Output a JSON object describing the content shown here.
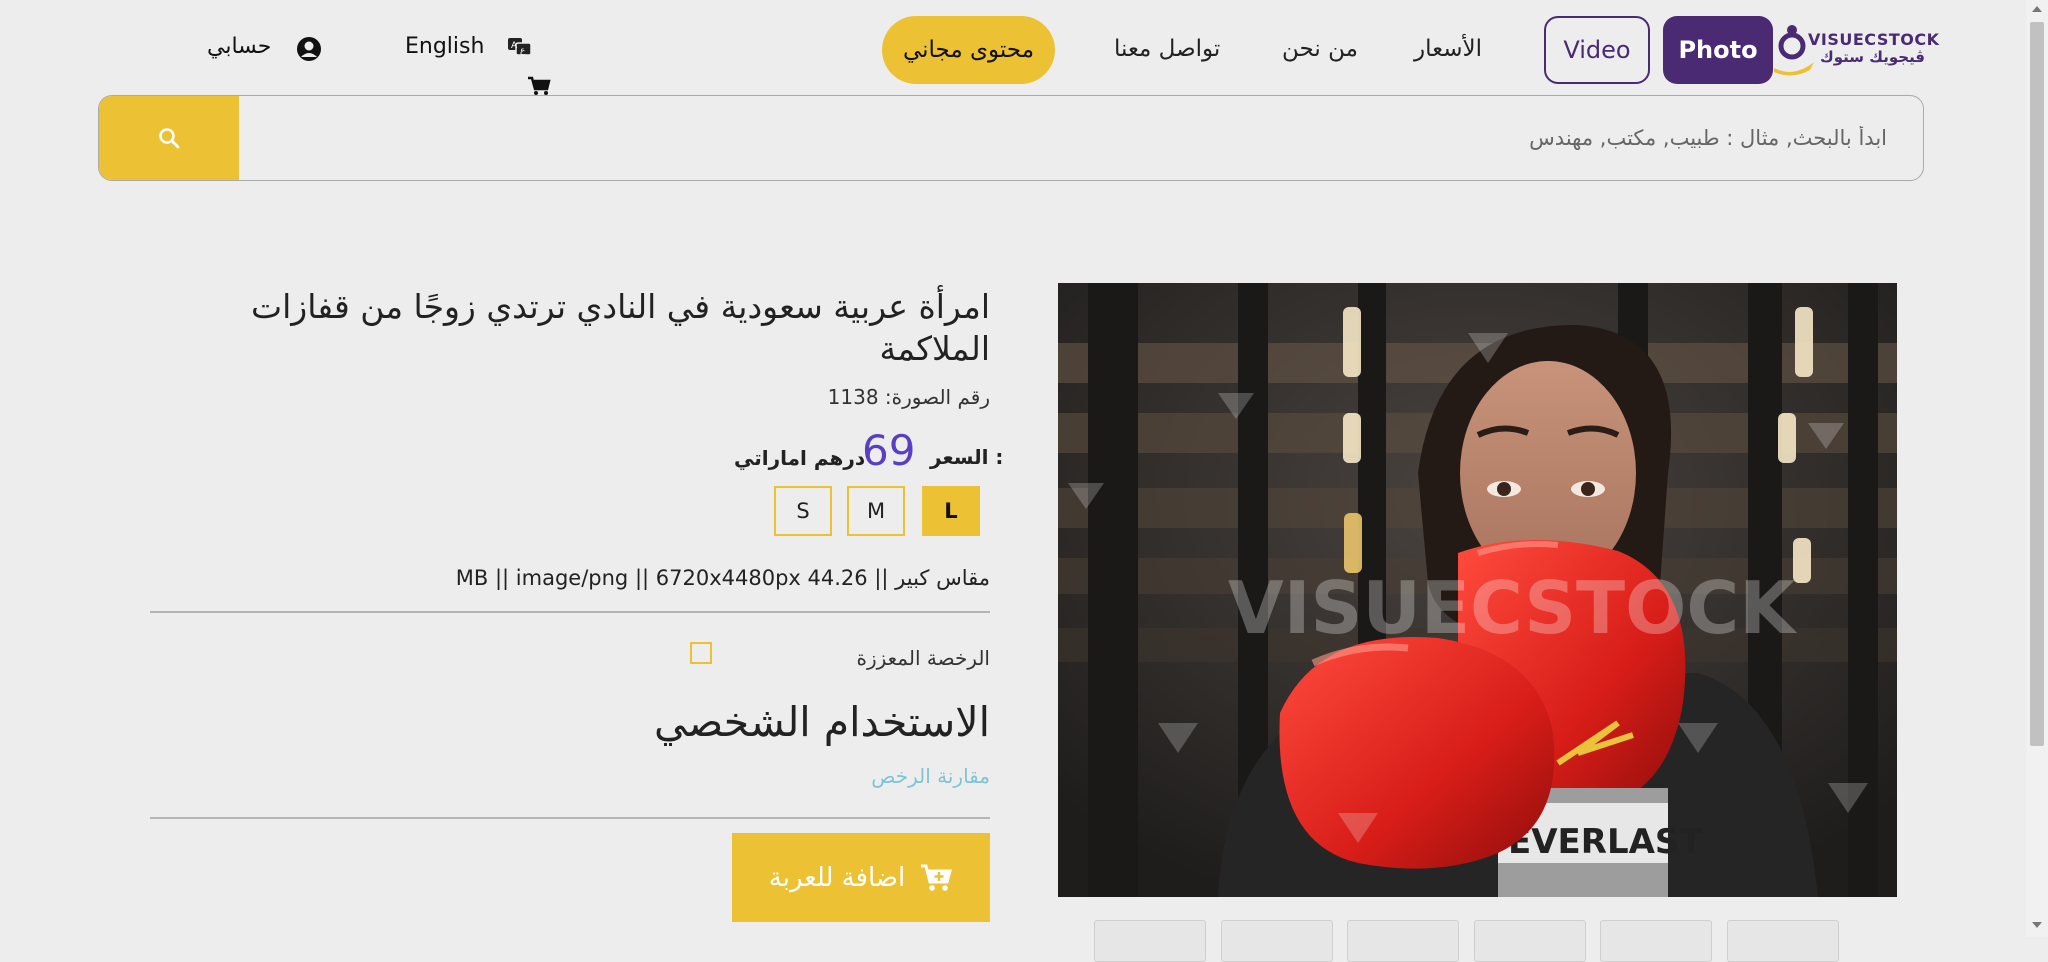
{
  "header": {
    "logo_text_en": "VISUECSTOCK",
    "logo_text_ar": "ڤيجويك ستوك",
    "photo_button": "Photo",
    "video_button": "Video",
    "nav": {
      "pricing": "الأسعار",
      "about": "من نحن",
      "contact": "تواصل معنا"
    },
    "free_content": "محتوى مجاني",
    "language": "English",
    "account": "حسابي"
  },
  "search": {
    "placeholder": "ابدأ بالبحث, مثال : طبيب, مكتب, مهندس",
    "value": ""
  },
  "product": {
    "title": "امرأة عربية سعودية في النادي ترتدي زوجًا من قفازات الملاكمة",
    "photo_number": "رقم الصورة: 1138",
    "price_label": "السعر :",
    "price_value": "69",
    "currency": "درهم اماراتي",
    "sizes": [
      "L",
      "M",
      "S"
    ],
    "selected_size": "L",
    "specs": "مقاس كبير || 44.26 MB || image/png || 6720x4480px",
    "extended_license_label": "الرخصة المعززة",
    "extended_license_checked": false,
    "license_type": "الاستخدام الشخصي",
    "compare_licenses": "مقارنة الرخص",
    "add_to_cart": "اضافة للعربة"
  },
  "image": {
    "watermark": "VISUECSTOCK",
    "glove_brand": "EVERLAST"
  },
  "colors": {
    "accent": "#ecc133",
    "brand_purple": "#4a2a73",
    "price": "#5a3fbf",
    "link": "#7fc4d4"
  }
}
